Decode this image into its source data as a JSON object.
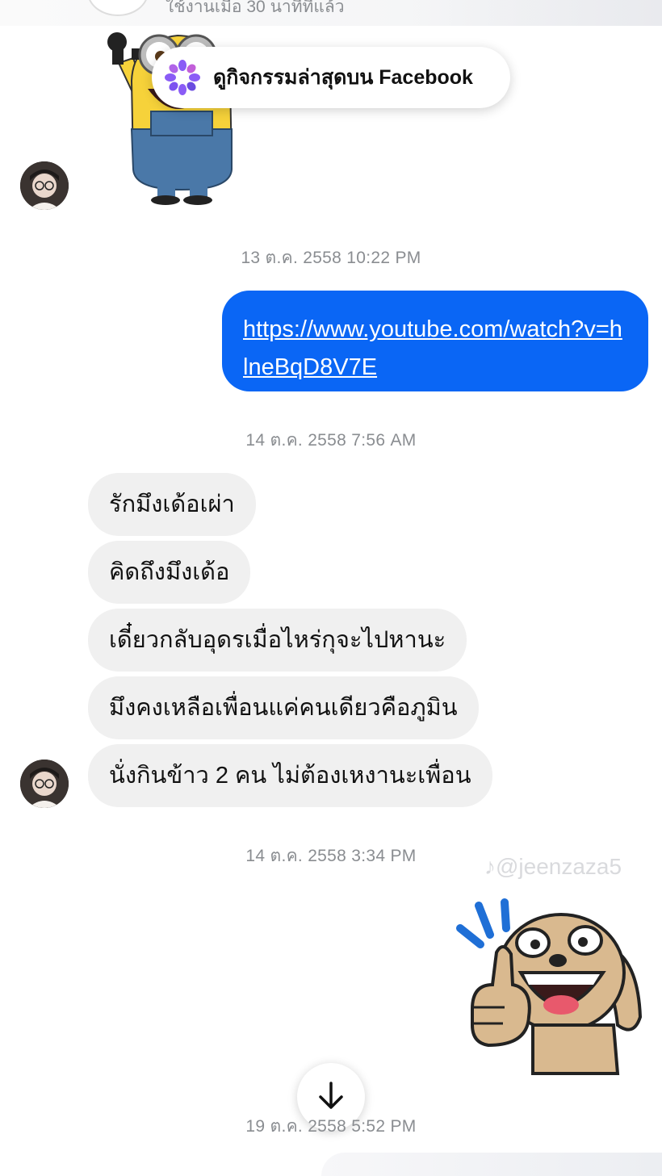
{
  "header": {
    "status_partial": "ใช้งานเมื่อ 30 นาทีที่แล้ว"
  },
  "facebook_pill": {
    "label": "ดูกิจกรรมล่าสุดบน Facebook",
    "icon": "facebook-activity-icon",
    "icon_color": "#8a5cf6"
  },
  "messages": {
    "timestamps": [
      "13 ต.ค. 2558 10:22 PM",
      "14 ต.ค. 2558 7:56 AM",
      "14 ต.ค. 2558 3:34 PM",
      "19 ต.ค. 2558 5:52 PM"
    ],
    "outgoing_link": "https://www.youtube.com/watch?v=hlneBqD8V7E",
    "incoming": [
      "รักมึงเด้อเผ่า",
      "คิดถึงมึงเด้อ",
      "เดี๋ยวกลับอุดรเมื่อไหร่กุจะไปหานะ",
      "มึงคงเหลือเพื่อนแค่คนเดียวคือภูมิน",
      "นั่งกินข้าว 2 คน ไม่ต้องเหงานะเพื่อน"
    ]
  },
  "watermark": "@jeenzaza5",
  "colors": {
    "outgoing_bubble": "#0a66f5",
    "incoming_bubble": "#f0f0f0",
    "timestamp_text": "#8a8d91"
  },
  "stickers": [
    "minion-sticker",
    "thumbs-up-dog-sticker"
  ],
  "scroll_button_icon": "arrow-down-icon"
}
